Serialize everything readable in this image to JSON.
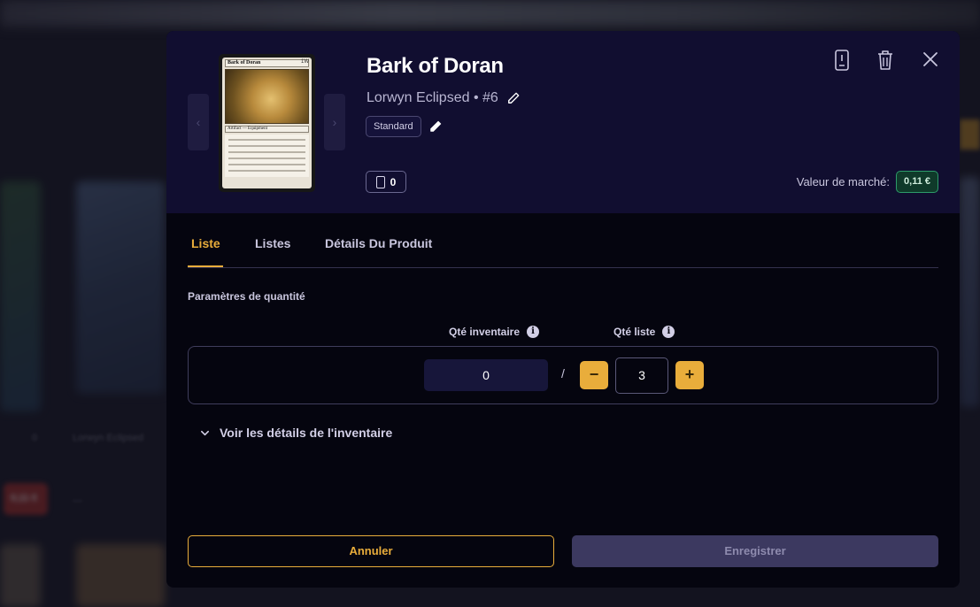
{
  "background": {
    "bg_set_name": "Lorwyn Eclipsed",
    "bg_qty": "0",
    "bg_price": "0,11 €",
    "bg_dash": "—"
  },
  "product": {
    "title": "Bark of Doran",
    "set_line": "Lorwyn Eclipsed • #6",
    "condition": "Standard",
    "owned_count": "0",
    "card_image": {
      "name": "Bark of Doran",
      "type_line": "Artifact — Equipment",
      "mana_cost": "1W"
    }
  },
  "header": {
    "phone_icon": "mobile-phone-icon",
    "trash_icon": "trash-icon",
    "close_icon": "close-icon"
  },
  "market": {
    "label": "Valeur de marché:",
    "price": "0,11 €",
    "price_color": "#2d9b6a"
  },
  "tabs": [
    {
      "label": "Liste",
      "active": true
    },
    {
      "label": "Listes",
      "active": false
    },
    {
      "label": "Détails Du Produit",
      "active": false
    }
  ],
  "quantity": {
    "section_title": "Paramètres de quantité",
    "inventory_label": "Qté inventaire",
    "list_label": "Qté liste",
    "inventory_value": "0",
    "separator": "/",
    "list_value": "3",
    "minus": "−",
    "plus": "+"
  },
  "details_toggle": "Voir les détails de l'inventaire",
  "actions": {
    "cancel": "Annuler",
    "save": "Enregistrer"
  },
  "colors": {
    "accent": "#e9ad3b",
    "modal_bg": "#05050f",
    "header_bg": "#110e30"
  }
}
